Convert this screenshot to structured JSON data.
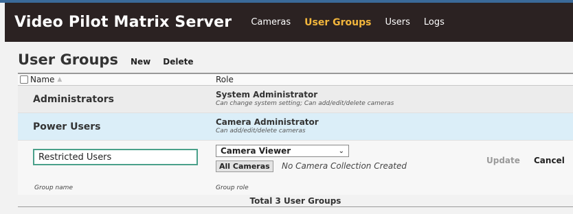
{
  "app": {
    "title": "Video Pilot Matrix Server",
    "nav": [
      "Cameras",
      "User Groups",
      "Users",
      "Logs"
    ],
    "active_nav": "User Groups"
  },
  "page": {
    "title": "User Groups",
    "actions": {
      "new": "New",
      "delete": "Delete"
    }
  },
  "table": {
    "columns": {
      "name": "Name",
      "role": "Role"
    },
    "rows": [
      {
        "name": "Administrators",
        "role_title": "System Administrator",
        "role_desc": "Can change system setting; Can add/edit/delete cameras"
      },
      {
        "name": "Power Users",
        "role_title": "Camera Administrator",
        "role_desc": "Can add/edit/delete cameras"
      }
    ],
    "edit_row": {
      "name_value": "Restricted Users",
      "role_selected": "Camera Viewer",
      "all_cameras_label": "All Cameras",
      "no_collection_text": "No Camera Collection Created",
      "update_label": "Update",
      "cancel_label": "Cancel",
      "name_hint": "Group name",
      "role_hint": "Group role"
    },
    "total": "Total 3 User Groups"
  },
  "colors": {
    "header_bg": "#2b2222",
    "nav_active": "#f2b63c",
    "selected_row": "#dbeef8",
    "input_border": "#4aa08a"
  }
}
